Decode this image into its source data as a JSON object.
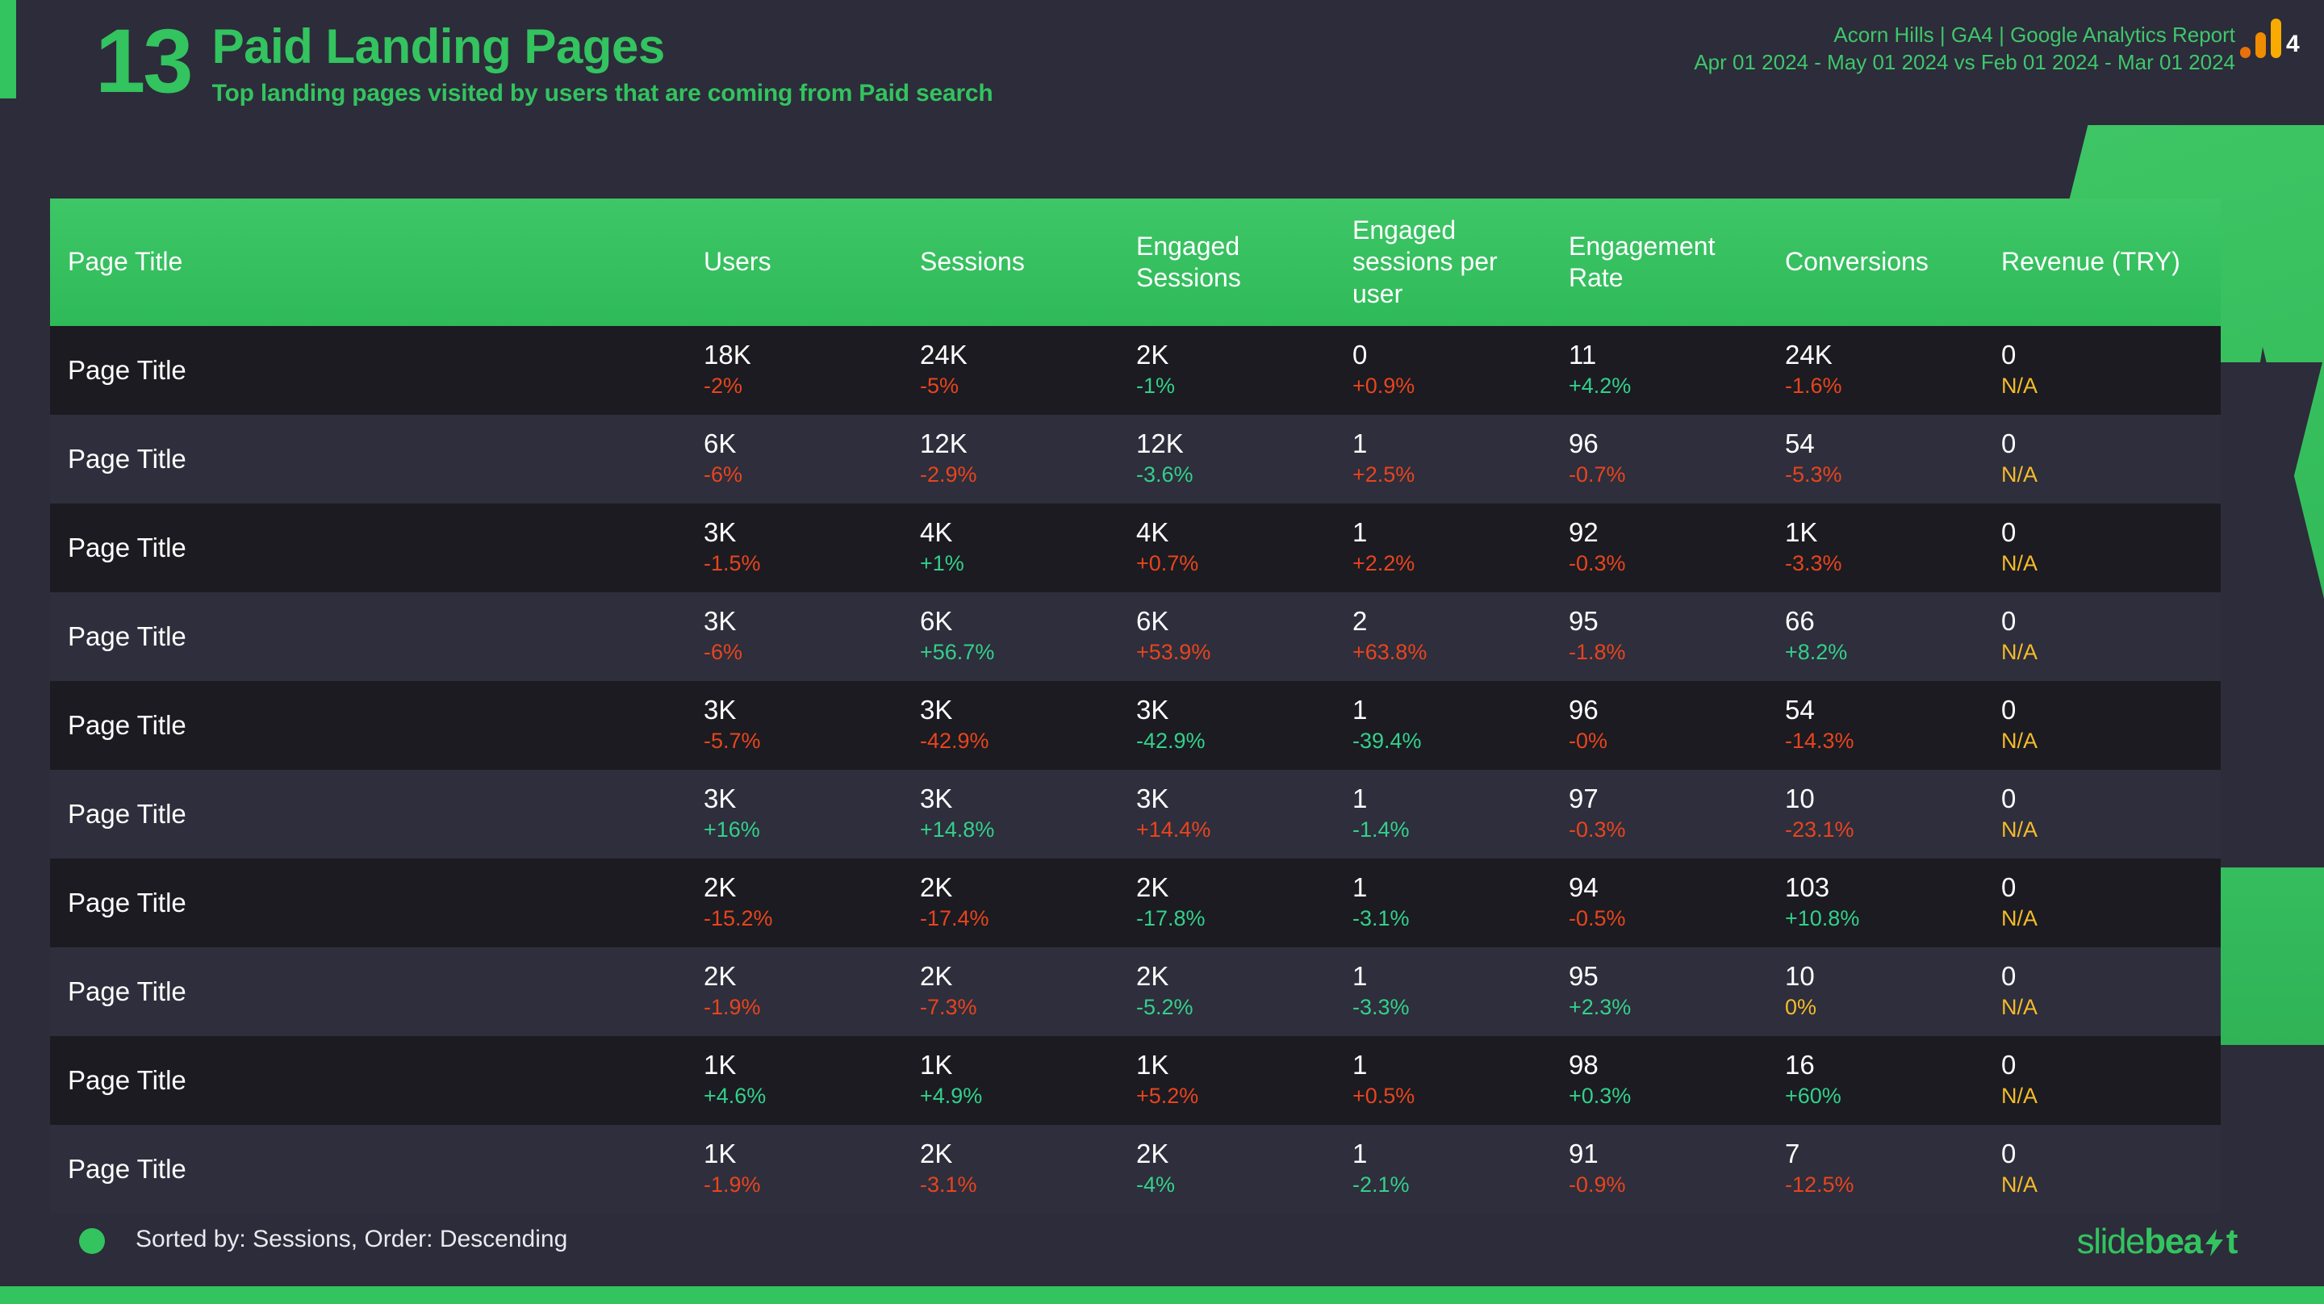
{
  "header": {
    "kpi_number": "13",
    "title": "Paid Landing Pages",
    "subtitle": "Top landing pages visited by users that are coming from Paid search",
    "meta_line_1": "Acorn Hills | GA4 | Google Analytics Report",
    "meta_line_2": "Apr 01 2024 - May 01 2024 vs Feb 01 2024 - Mar 01 2024",
    "ga4_badge": "4"
  },
  "colors": {
    "brand_green": "#33c35f",
    "header_green": "#3ec667",
    "up_green": "#33d08a",
    "down_red": "#e8441d",
    "na_amber": "#f5bb2a",
    "row_odd": "#1b1b21",
    "row_even": "#2e2e3c",
    "page_bg": "#2c2c3a"
  },
  "table": {
    "columns": [
      "Page Title",
      "Users",
      "Sessions",
      "Engaged Sessions",
      "Engaged sessions per user",
      "Engagement Rate",
      "Conversions",
      "Revenue (TRY)"
    ],
    "rows": [
      {
        "title": "Page Title",
        "cells": [
          {
            "value": "18K",
            "delta": "-2%",
            "trend": "down"
          },
          {
            "value": "24K",
            "delta": "-5%",
            "trend": "down"
          },
          {
            "value": "2K",
            "delta": "-1%",
            "trend": "up"
          },
          {
            "value": "0",
            "delta": "+0.9%",
            "trend": "down"
          },
          {
            "value": "11",
            "delta": "+4.2%",
            "trend": "up"
          },
          {
            "value": "24K",
            "delta": "-1.6%",
            "trend": "down"
          },
          {
            "value": "0",
            "delta": "N/A",
            "trend": "na"
          }
        ]
      },
      {
        "title": "Page Title",
        "cells": [
          {
            "value": "6K",
            "delta": "-6%",
            "trend": "down"
          },
          {
            "value": "12K",
            "delta": "-2.9%",
            "trend": "down"
          },
          {
            "value": "12K",
            "delta": "-3.6%",
            "trend": "up"
          },
          {
            "value": "1",
            "delta": "+2.5%",
            "trend": "down"
          },
          {
            "value": "96",
            "delta": "-0.7%",
            "trend": "down"
          },
          {
            "value": "54",
            "delta": "-5.3%",
            "trend": "down"
          },
          {
            "value": "0",
            "delta": "N/A",
            "trend": "na"
          }
        ]
      },
      {
        "title": "Page Title",
        "cells": [
          {
            "value": "3K",
            "delta": "-1.5%",
            "trend": "down"
          },
          {
            "value": "4K",
            "delta": "+1%",
            "trend": "up"
          },
          {
            "value": "4K",
            "delta": "+0.7%",
            "trend": "down"
          },
          {
            "value": "1",
            "delta": "+2.2%",
            "trend": "down"
          },
          {
            "value": "92",
            "delta": "-0.3%",
            "trend": "down"
          },
          {
            "value": "1K",
            "delta": "-3.3%",
            "trend": "down"
          },
          {
            "value": "0",
            "delta": "N/A",
            "trend": "na"
          }
        ]
      },
      {
        "title": "Page Title",
        "cells": [
          {
            "value": "3K",
            "delta": "-6%",
            "trend": "down"
          },
          {
            "value": "6K",
            "delta": "+56.7%",
            "trend": "up"
          },
          {
            "value": "6K",
            "delta": "+53.9%",
            "trend": "down"
          },
          {
            "value": "2",
            "delta": "+63.8%",
            "trend": "down"
          },
          {
            "value": "95",
            "delta": "-1.8%",
            "trend": "down"
          },
          {
            "value": "66",
            "delta": "+8.2%",
            "trend": "up"
          },
          {
            "value": "0",
            "delta": "N/A",
            "trend": "na"
          }
        ]
      },
      {
        "title": "Page Title",
        "cells": [
          {
            "value": "3K",
            "delta": "-5.7%",
            "trend": "down"
          },
          {
            "value": "3K",
            "delta": "-42.9%",
            "trend": "down"
          },
          {
            "value": "3K",
            "delta": "-42.9%",
            "trend": "up"
          },
          {
            "value": "1",
            "delta": "-39.4%",
            "trend": "up"
          },
          {
            "value": "96",
            "delta": "-0%",
            "trend": "down"
          },
          {
            "value": "54",
            "delta": "-14.3%",
            "trend": "down"
          },
          {
            "value": "0",
            "delta": "N/A",
            "trend": "na"
          }
        ]
      },
      {
        "title": "Page Title",
        "cells": [
          {
            "value": "3K",
            "delta": "+16%",
            "trend": "up"
          },
          {
            "value": "3K",
            "delta": "+14.8%",
            "trend": "up"
          },
          {
            "value": "3K",
            "delta": "+14.4%",
            "trend": "down"
          },
          {
            "value": "1",
            "delta": "-1.4%",
            "trend": "up"
          },
          {
            "value": "97",
            "delta": "-0.3%",
            "trend": "down"
          },
          {
            "value": "10",
            "delta": "-23.1%",
            "trend": "down"
          },
          {
            "value": "0",
            "delta": "N/A",
            "trend": "na"
          }
        ]
      },
      {
        "title": "Page Title",
        "cells": [
          {
            "value": "2K",
            "delta": "-15.2%",
            "trend": "down"
          },
          {
            "value": "2K",
            "delta": "-17.4%",
            "trend": "down"
          },
          {
            "value": "2K",
            "delta": "-17.8%",
            "trend": "up"
          },
          {
            "value": "1",
            "delta": "-3.1%",
            "trend": "up"
          },
          {
            "value": "94",
            "delta": "-0.5%",
            "trend": "down"
          },
          {
            "value": "103",
            "delta": "+10.8%",
            "trend": "up"
          },
          {
            "value": "0",
            "delta": "N/A",
            "trend": "na"
          }
        ]
      },
      {
        "title": "Page Title",
        "cells": [
          {
            "value": "2K",
            "delta": "-1.9%",
            "trend": "down"
          },
          {
            "value": "2K",
            "delta": "-7.3%",
            "trend": "down"
          },
          {
            "value": "2K",
            "delta": "-5.2%",
            "trend": "up"
          },
          {
            "value": "1",
            "delta": "-3.3%",
            "trend": "up"
          },
          {
            "value": "95",
            "delta": "+2.3%",
            "trend": "up"
          },
          {
            "value": "10",
            "delta": "0%",
            "trend": "na"
          },
          {
            "value": "0",
            "delta": "N/A",
            "trend": "na"
          }
        ]
      },
      {
        "title": "Page Title",
        "cells": [
          {
            "value": "1K",
            "delta": "+4.6%",
            "trend": "up"
          },
          {
            "value": "1K",
            "delta": "+4.9%",
            "trend": "up"
          },
          {
            "value": "1K",
            "delta": "+5.2%",
            "trend": "down"
          },
          {
            "value": "1",
            "delta": "+0.5%",
            "trend": "down"
          },
          {
            "value": "98",
            "delta": "+0.3%",
            "trend": "up"
          },
          {
            "value": "16",
            "delta": "+60%",
            "trend": "up"
          },
          {
            "value": "0",
            "delta": "N/A",
            "trend": "na"
          }
        ]
      },
      {
        "title": "Page Title",
        "cells": [
          {
            "value": "1K",
            "delta": "-1.9%",
            "trend": "down"
          },
          {
            "value": "2K",
            "delta": "-3.1%",
            "trend": "down"
          },
          {
            "value": "2K",
            "delta": "-4%",
            "trend": "up"
          },
          {
            "value": "1",
            "delta": "-2.1%",
            "trend": "up"
          },
          {
            "value": "91",
            "delta": "-0.9%",
            "trend": "down"
          },
          {
            "value": "7",
            "delta": "-12.5%",
            "trend": "down"
          },
          {
            "value": "0",
            "delta": "N/A",
            "trend": "na"
          }
        ]
      }
    ]
  },
  "footer": {
    "sort_note": "Sorted by: Sessions, Order: Descending",
    "brand_part_1": "slide",
    "brand_part_2": "bea",
    "brand_part_3": "t"
  }
}
